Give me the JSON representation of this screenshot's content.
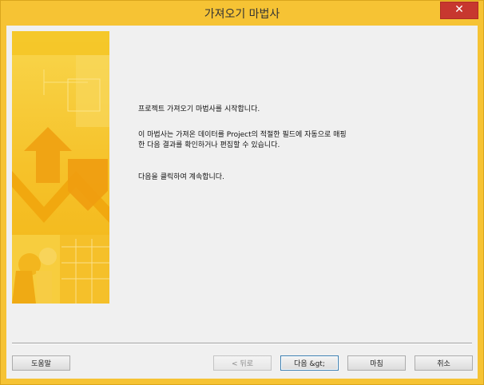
{
  "window": {
    "title": "가져오기 마법사",
    "close_label": "✕"
  },
  "content": {
    "intro": "프로젝트 가져오기 마법사를 시작합니다.",
    "description_line1": "이 마법사는 가져온 데이터를 Project의 적절한 필드에 자동으로 매핑",
    "description_line2": "한 다음 결과를 확인하거나 편집할 수 있습니다.",
    "instruction": "다음을 클릭하여 계속합니다."
  },
  "buttons": {
    "help": "도움말",
    "back": "< 뒤로",
    "next": "다음 &gt;",
    "finish": "마침",
    "cancel": "취소"
  },
  "colors": {
    "accent": "#f6c334",
    "close": "#c7372f"
  }
}
